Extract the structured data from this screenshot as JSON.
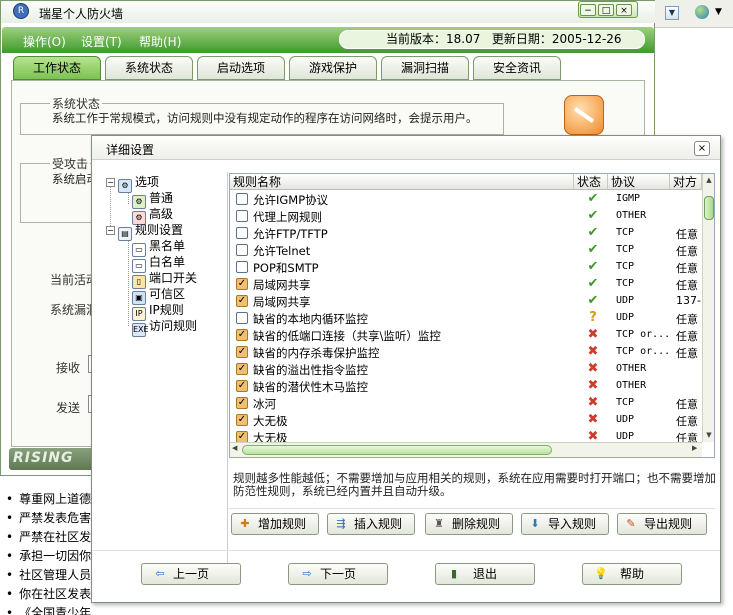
{
  "bg_window": {
    "title": "瑞星个人防火墙",
    "controls": [
      "−",
      "□",
      "×"
    ],
    "menu": [
      "操作(O)",
      "设置(T)",
      "帮助(H)"
    ],
    "version_label": "当前版本：18.07",
    "update_label": "更新日期：2005-12-26",
    "tabs": [
      "工作状态",
      "系统状态",
      "启动选项",
      "游戏保护",
      "漏洞扫描",
      "安全资讯"
    ],
    "status_group_title": "系统状态",
    "status_group_text": "系统工作于常规模式，访问规则中没有规定动作的程序在访问网络时，会提示用户。",
    "attack_group_title": "受攻击",
    "attack_group_text": "系统启动",
    "label_active": "当前活动",
    "label_vuln": "系统漏洞",
    "label_receive": "接收",
    "label_send": "发送",
    "brand": "RISING"
  },
  "bullets": [
    "尊重网上道德",
    "严禁发表危害",
    "严禁在社区发",
    "承担一切因你",
    "社区管理人员",
    "你在社区发表",
    "《全国青少年"
  ],
  "dialog": {
    "title": "详细设置",
    "close": "×",
    "tree": {
      "options": "选项",
      "normal": "普通",
      "advanced": "高级",
      "rules": "规则设置",
      "blacklist": "黑名单",
      "whitelist": "白名单",
      "ports": "端口开关",
      "trusted": "可信区",
      "ip_rules": "IP规则",
      "access_rules": "访问规则"
    },
    "columns": [
      "规则名称",
      "状态",
      "协议",
      "对方"
    ],
    "rows": [
      {
        "checked": false,
        "name": "允许IGMP协议",
        "status": "ok",
        "protocol": "IGMP",
        "peer": ""
      },
      {
        "checked": false,
        "name": "代理上网规则",
        "status": "ok",
        "protocol": "OTHER",
        "peer": ""
      },
      {
        "checked": false,
        "name": "允许FTP/TFTP",
        "status": "ok",
        "protocol": "TCP",
        "peer": "任意"
      },
      {
        "checked": false,
        "name": "允许Telnet",
        "status": "ok",
        "protocol": "TCP",
        "peer": "任意"
      },
      {
        "checked": false,
        "name": "POP和SMTP",
        "status": "ok",
        "protocol": "TCP",
        "peer": "任意"
      },
      {
        "checked": true,
        "name": "局域网共享",
        "status": "ok",
        "protocol": "TCP",
        "peer": "任意"
      },
      {
        "checked": true,
        "name": "局域网共享",
        "status": "ok",
        "protocol": "UDP",
        "peer": "137-"
      },
      {
        "checked": false,
        "name": "缺省的本地内循环监控",
        "status": "q",
        "protocol": "UDP",
        "peer": "任意"
      },
      {
        "checked": true,
        "name": "缺省的低端口连接（共享\\监听）监控",
        "status": "no",
        "protocol": "TCP or...",
        "peer": "任意"
      },
      {
        "checked": true,
        "name": "缺省的内存杀毒保护监控",
        "status": "no",
        "protocol": "TCP or...",
        "peer": "任意"
      },
      {
        "checked": true,
        "name": "缺省的溢出性指令监控",
        "status": "no",
        "protocol": "OTHER",
        "peer": ""
      },
      {
        "checked": true,
        "name": "缺省的潜伏性木马监控",
        "status": "no",
        "protocol": "OTHER",
        "peer": ""
      },
      {
        "checked": true,
        "name": "冰河",
        "status": "no",
        "protocol": "TCP",
        "peer": "任意"
      },
      {
        "checked": true,
        "name": "大无极",
        "status": "no",
        "protocol": "UDP",
        "peer": "任意"
      },
      {
        "checked": true,
        "name": "大无极",
        "status": "no",
        "protocol": "UDP",
        "peer": "任意"
      }
    ],
    "note": "规则越多性能越低；不需要增加与应用相关的规则，系统在应用需要时打开端口；也不需要增加防范性规则，系统已经内置并且自动升级。",
    "buttons": {
      "add": "增加规则",
      "insert": "插入规则",
      "delete": "删除规则",
      "import": "导入规则",
      "export": "导出规则"
    },
    "nav": {
      "prev": "上一页",
      "next": "下一页",
      "exit": "退出",
      "help": "帮助"
    }
  }
}
